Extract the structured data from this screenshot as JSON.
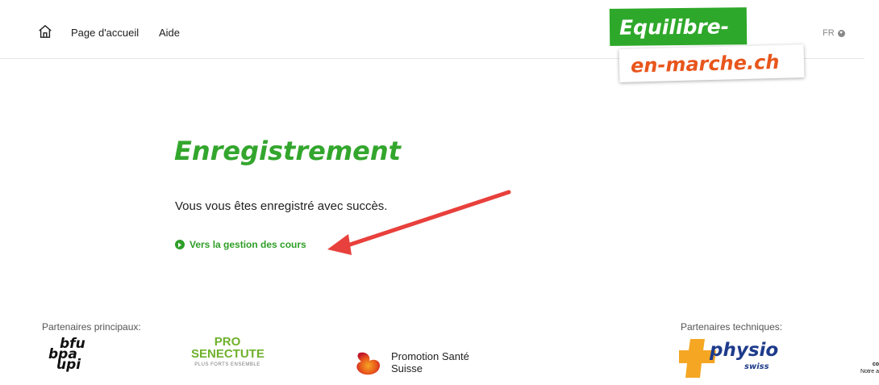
{
  "header": {
    "nav": [
      "Page d'accueil",
      "Aide"
    ],
    "lang": "FR"
  },
  "logo": {
    "line1": "Equilibre-",
    "line2": "en-marche.ch"
  },
  "main": {
    "title": "Enregistrement",
    "message": "Vous vous êtes enregistré avec succès.",
    "link": "Vers la gestion des cours"
  },
  "footer": {
    "main_partners_label": "Partenaires principaux:",
    "tech_partners_label": "Partenaires techniques:",
    "bfu_lines": [
      "bfu",
      "bpa",
      "upi"
    ],
    "pro_senectute": [
      "PRO",
      "SENECTUTE",
      "PLUS FORTS ENSEMBLE"
    ],
    "promotion_sante": [
      "Promotion Santé",
      "Suisse"
    ],
    "physio": [
      "physio",
      "swiss"
    ],
    "cutoff_text": [
      "co",
      "Notre a"
    ]
  },
  "colors": {
    "brand_green": "#33a62d",
    "brand_orange": "#e8561c",
    "annotation_arrow": "#e8403c"
  }
}
